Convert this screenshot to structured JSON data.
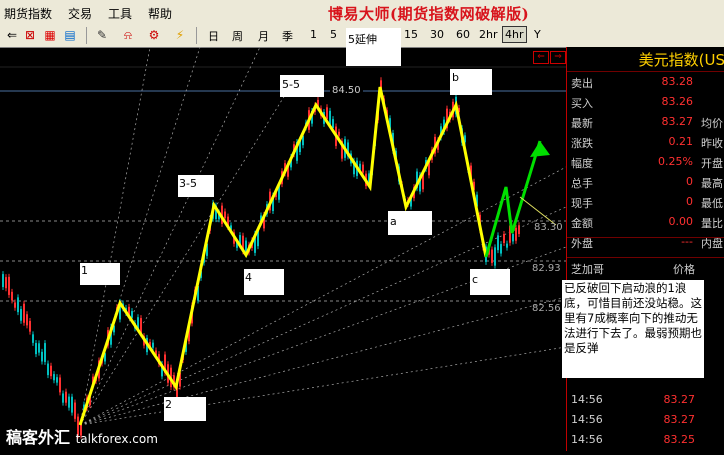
{
  "menu": {
    "items": [
      "期货指数",
      "交易",
      "工具",
      "帮助"
    ],
    "app_title": "博易大师(期货指数网破解版)"
  },
  "toolbar": {
    "periods": [
      "日",
      "周",
      "月",
      "季",
      "1",
      "5",
      "15",
      "30",
      "60",
      "2hr",
      "4hr",
      "Y"
    ],
    "active_period": "4hr"
  },
  "chart": {
    "wave_labels": {
      "w1": "1",
      "w2": "2",
      "w3": "3-5",
      "w4": "4",
      "w5a": "5-5",
      "w5": "5延伸",
      "a": "a",
      "b": "b",
      "c": "c"
    },
    "price_labels": [
      "84.50",
      "83.30",
      "82.93",
      "82.56"
    ],
    "colors": {
      "wave": "#ffff00",
      "projection": "#00e000",
      "up_candle": "#ff3030",
      "down_candle": "#00c0c0"
    }
  },
  "panel": {
    "title": "美元指数(US",
    "rows": [
      {
        "label": "卖出",
        "value": "83.28",
        "label2": ""
      },
      {
        "label": "买入",
        "value": "83.26",
        "label2": ""
      },
      {
        "label": "最新",
        "value": "83.27",
        "label2": "均价"
      },
      {
        "label": "涨跌",
        "value": "0.21",
        "label2": "昨收"
      },
      {
        "label": "幅度",
        "value": "0.25%",
        "label2": "开盘"
      },
      {
        "label": "总手",
        "value": "0",
        "label2": "最高"
      },
      {
        "label": "现手",
        "value": "0",
        "label2": "最低"
      },
      {
        "label": "金额",
        "value": "0.00",
        "label2": "量比"
      },
      {
        "label": "外盘",
        "value": "---",
        "label2": "内盘"
      }
    ],
    "trade_header": {
      "col1": "芝加哥",
      "col2": "价格"
    },
    "trades": [
      {
        "time": "14:56",
        "price": "83.27"
      },
      {
        "time": "14:56",
        "price": "83.27"
      },
      {
        "time": "14:56",
        "price": "83.25"
      }
    ]
  },
  "comment": "已反破回下启动浪的1浪底，可惜目前还没站稳。这里有7成概率向下的推动无法进行下去了。最弱预期也是反弹",
  "watermark": {
    "text": "稿客外汇",
    "url": "talkforex.com"
  }
}
